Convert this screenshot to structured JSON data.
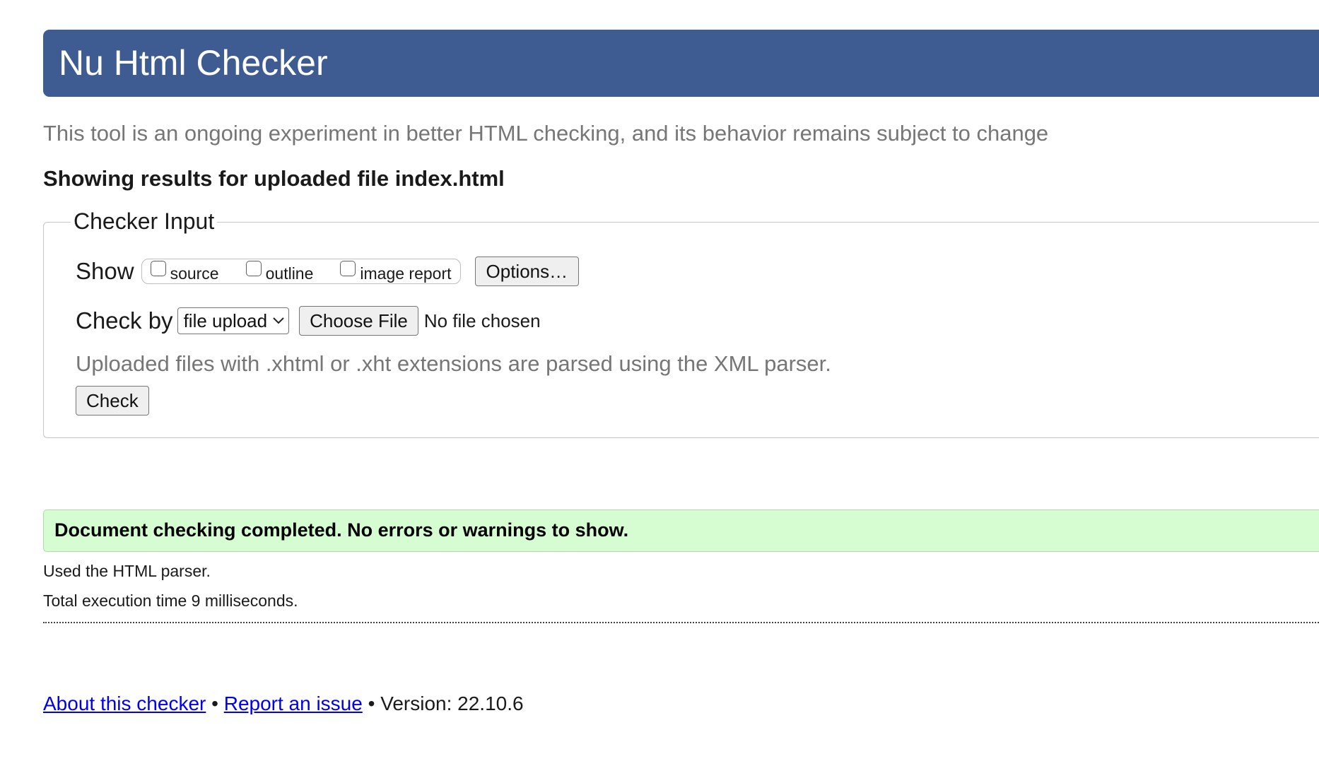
{
  "header": {
    "title": "Nu Html Checker"
  },
  "tagline": "This tool is an ongoing experiment in better HTML checking, and its behavior remains subject to change",
  "results_title": "Showing results for uploaded file index.html",
  "checker_input": {
    "legend": "Checker Input",
    "show_label": "Show",
    "show_options": [
      {
        "label": "source",
        "checked": false
      },
      {
        "label": "outline",
        "checked": false
      },
      {
        "label": "image report",
        "checked": false
      }
    ],
    "options_button": "Options…",
    "check_by_label": "Check by",
    "check_by_selected": "file upload",
    "choose_file_button": "Choose File",
    "file_status": "No file chosen",
    "note": "Uploaded files with .xhtml or .xht extensions are parsed using the XML parser.",
    "check_button": "Check"
  },
  "result": {
    "message": "Document checking completed. No errors or warnings to show.",
    "parser_info": "Used the HTML parser.",
    "execution_time": "Total execution time 9 milliseconds."
  },
  "footer": {
    "about_link": "About this checker",
    "separator": "•",
    "report_link": "Report an issue",
    "version": "Version: 22.10.6"
  },
  "colors": {
    "banner": "#3e5c91",
    "success_bg": "#d6fcd2",
    "link": "#0000ee",
    "muted_text": "#767676"
  }
}
